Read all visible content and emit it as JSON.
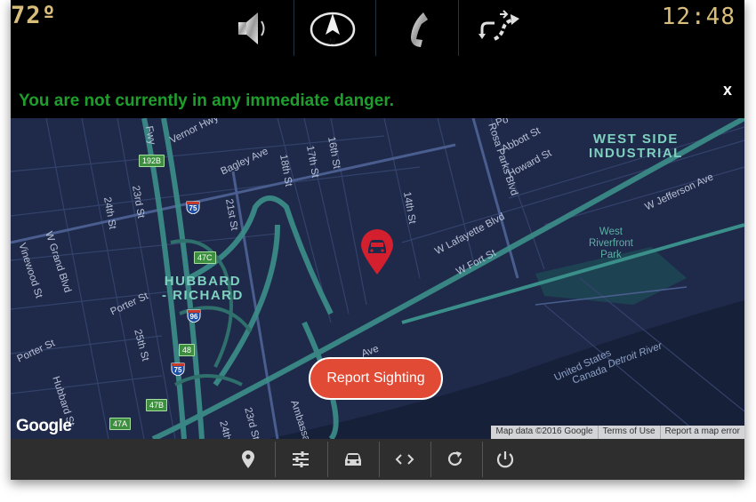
{
  "status_bar": {
    "temperature": "72º",
    "time": "12:48",
    "icons": [
      "speaker-icon",
      "compass-icon",
      "phone-icon",
      "route-icon"
    ],
    "compass_letter": "N"
  },
  "alert": {
    "message": "You are not currently in any immediate danger.",
    "close_label": "x"
  },
  "map": {
    "districts": [
      "HUBBARD",
      "- RICHARD",
      "WEST SIDE",
      "INDUSTRIAL"
    ],
    "park": [
      "West",
      "Riverfront",
      "Park"
    ],
    "streets": [
      "Vernor Hwy",
      "Bagley Ave",
      "18th St",
      "17th St",
      "16th St",
      "14th St",
      "21st St",
      "23rd St",
      "24th St",
      "W Grand Blvd",
      "Vinewood St",
      "Porter St",
      "25th St",
      "Porter St",
      "Hubbard St",
      "Rosa Parks Blvd",
      "Abbott St",
      "Howard St",
      "W Lafayette Blvd",
      "W Fort St",
      "W Jefferson Ave",
      "Ave",
      "23rd St",
      "24th St",
      "Fwy",
      "Po"
    ],
    "waterway": [
      "United States",
      "Detroit River",
      "Canada"
    ],
    "bridge": "Ambassa",
    "exits": [
      "192B",
      "47C",
      "48",
      "47B",
      "47A"
    ],
    "shields": [
      "75",
      "96",
      "75"
    ],
    "logo": "Google",
    "attribution": [
      "Map data ©2016 Google",
      "Terms of Use",
      "Report a map error"
    ],
    "marker_icon": "car-location-pin-icon"
  },
  "report_button": {
    "label": "Report Sighting"
  },
  "bottom_bar": {
    "icons": [
      "location-pin-icon",
      "sliders-icon",
      "car-icon",
      "code-icon",
      "refresh-icon",
      "power-icon"
    ]
  },
  "colors": {
    "accent_gold": "#d8be7a",
    "alert_green": "#1f9e2d",
    "report_red": "#e14b36",
    "map_background": "#1f2a4a",
    "highway_teal": "#3b8f8a",
    "river": "#172039"
  }
}
